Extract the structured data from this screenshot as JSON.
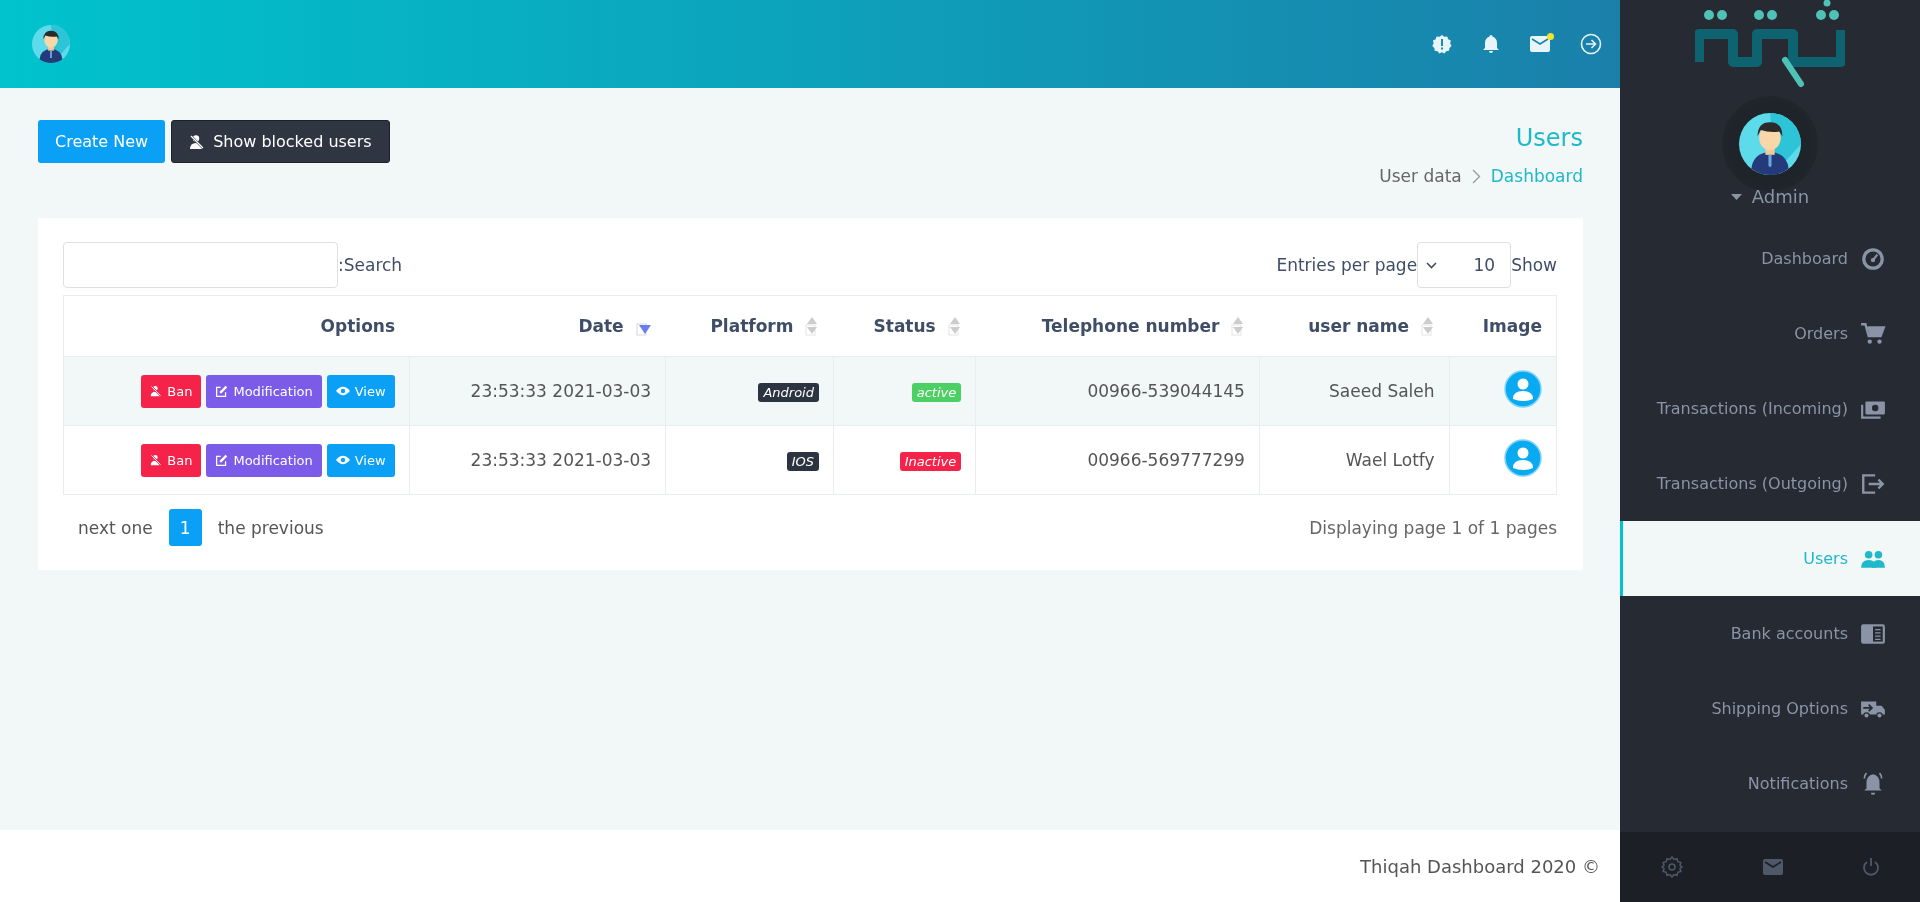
{
  "header": {
    "mail_badge": true
  },
  "actions": [
    {
      "label": "Create New",
      "kind": "primary"
    },
    {
      "label": "Show blocked users",
      "kind": "dark"
    }
  ],
  "page": {
    "title": "Users",
    "breadcrumb": [
      "User data",
      "Dashboard"
    ]
  },
  "table_controls": {
    "search_label": ":Search",
    "entries_label": "Entries per page",
    "entries_value": "10",
    "show_label": "Show"
  },
  "table": {
    "columns": [
      {
        "label": "Options",
        "sortable": false
      },
      {
        "label": "Date",
        "sortable": true,
        "sorted_descending": true
      },
      {
        "label": "Platform",
        "sortable": true,
        "sorted_descending": false
      },
      {
        "label": "Status",
        "sortable": true,
        "sorted_descending": false
      },
      {
        "label": "Telephone number",
        "sortable": true,
        "sorted_descending": false
      },
      {
        "label": "user name",
        "sortable": true,
        "sorted_descending": false
      },
      {
        "label": "Image",
        "sortable": false
      }
    ],
    "rows": [
      {
        "actions": [
          {
            "label": "Ban",
            "kind": "ban"
          },
          {
            "label": "Modification",
            "kind": "edit"
          },
          {
            "label": "View",
            "kind": "view"
          }
        ],
        "date": "23:53:33 2021-03-03",
        "platform": "Android",
        "status": {
          "label": "active",
          "kind": "active"
        },
        "telephone": "00966-539044145",
        "user_name": "Saeed Saleh"
      },
      {
        "actions": [
          {
            "label": "Ban",
            "kind": "ban"
          },
          {
            "label": "Modification",
            "kind": "edit"
          },
          {
            "label": "View",
            "kind": "view"
          }
        ],
        "date": "23:53:33 2021-03-03",
        "platform": "IOS",
        "status": {
          "label": "Inactive",
          "kind": "inactive"
        },
        "telephone": "00966-569777299",
        "user_name": "Wael Lotfy"
      }
    ]
  },
  "pagination": {
    "items": [
      {
        "label": "next one",
        "selected": false
      },
      {
        "label": "1",
        "selected": true
      },
      {
        "label": "the previous",
        "selected": false
      }
    ],
    "info": "Displaying page 1 of 1 pages"
  },
  "footer": "Thiqah Dashboard 2020 ©",
  "sidebar": {
    "user": "Admin",
    "items": [
      {
        "label": "Dashboard",
        "selected": false
      },
      {
        "label": "Orders",
        "selected": false
      },
      {
        "label": "Transactions (Incoming)",
        "selected": false
      },
      {
        "label": "Transactions (Outgoing)",
        "selected": false
      },
      {
        "label": "Users",
        "selected": true
      },
      {
        "label": "Bank accounts",
        "selected": false
      },
      {
        "label": "Shipping Options",
        "selected": false
      },
      {
        "label": "Notifications",
        "selected": false
      }
    ]
  }
}
